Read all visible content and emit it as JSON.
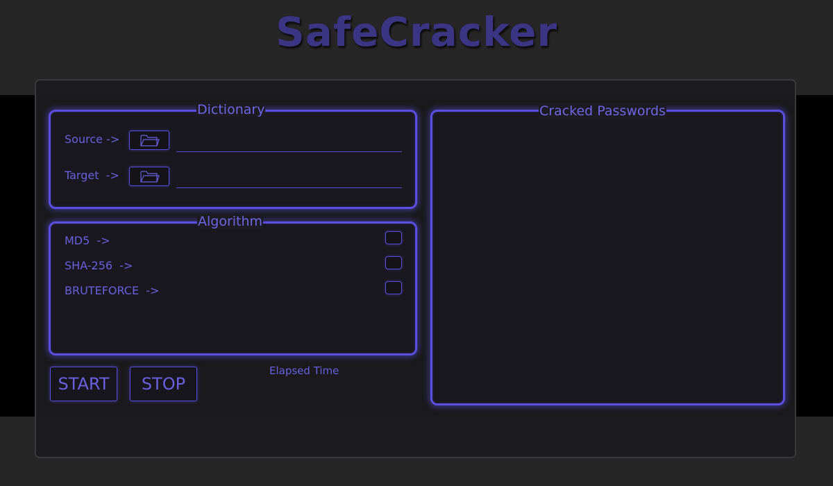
{
  "app": {
    "title": "SafeCracker"
  },
  "dictionary": {
    "legend": "Dictionary",
    "source_label": "Source ->",
    "source_value": "",
    "target_label": "Target  ->",
    "target_value": ""
  },
  "algorithm": {
    "legend": "Algorithm",
    "options": [
      {
        "label": "MD5  ->",
        "checked": false
      },
      {
        "label": "SHA-256  ->",
        "checked": false
      },
      {
        "label": "BRUTEFORCE  ->",
        "checked": false
      }
    ]
  },
  "controls": {
    "start_label": "START",
    "stop_label": "STOP",
    "elapsed_label": "Elapsed Time"
  },
  "results": {
    "legend": "Cracked Passwords",
    "items": []
  },
  "icons": {
    "folder": "folder-open-icon"
  },
  "colors": {
    "accent": "#5a4fe0",
    "text": "#6a60e0",
    "title": "#3b3584",
    "background": "#262626",
    "band": "#000000"
  }
}
